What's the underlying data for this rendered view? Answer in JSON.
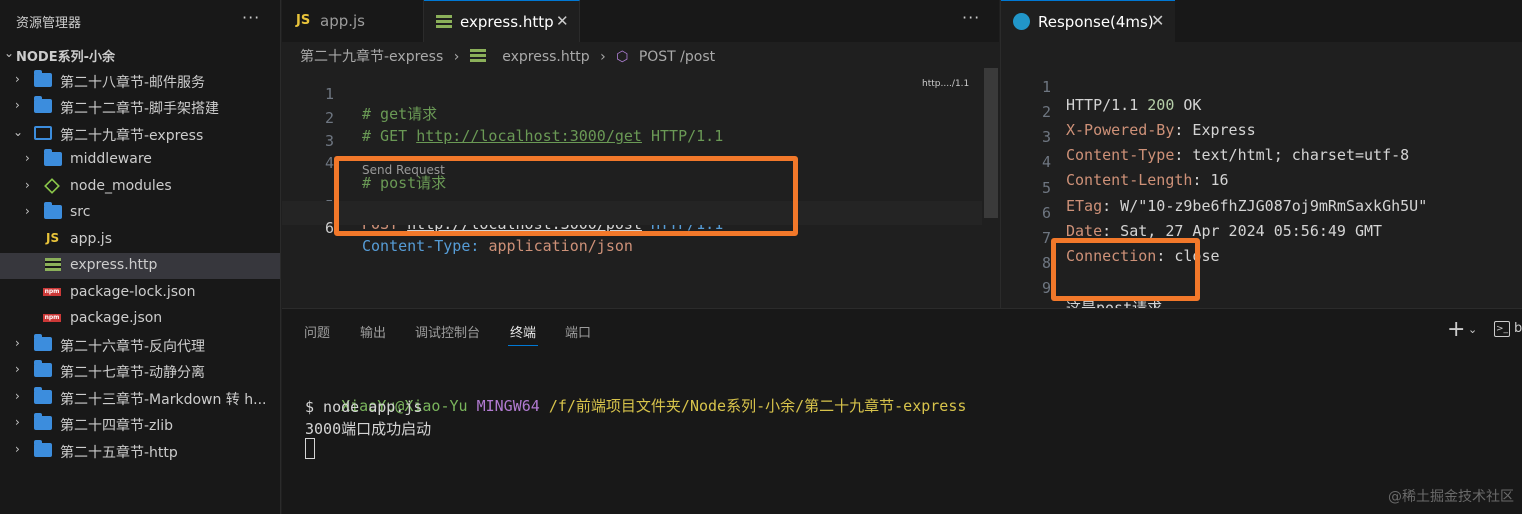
{
  "sidebar": {
    "title": "资源管理器",
    "more": "···",
    "root": "NODE系列-小余",
    "items": [
      {
        "label": "第二十八章节-邮件服务"
      },
      {
        "label": "第二十二章节-脚手架搭建"
      },
      {
        "label": "第二十九章节-express"
      },
      {
        "label": "middleware"
      },
      {
        "label": "node_modules"
      },
      {
        "label": "src"
      },
      {
        "label": "app.js"
      },
      {
        "label": "express.http"
      },
      {
        "label": "package-lock.json"
      },
      {
        "label": "package.json"
      },
      {
        "label": "第二十六章节-反向代理"
      },
      {
        "label": "第二十七章节-动静分离"
      },
      {
        "label": "第二十三章节-Markdown 转 h..."
      },
      {
        "label": "第二十四章节-zlib"
      },
      {
        "label": "第二十五章节-http"
      }
    ]
  },
  "editor": {
    "tabs": [
      {
        "icon": "JS",
        "label": "app.js"
      },
      {
        "label": "express.http",
        "close": "✕"
      }
    ],
    "more": "···",
    "breadcrumb": {
      "folder": "第二十九章节-express",
      "sep1": "›",
      "file": "express.http",
      "sep2": "›",
      "symbol": "POST /post"
    },
    "code_lens": "Send Request",
    "minimap_label": "http..../1.1",
    "lines": [
      {
        "n": "1",
        "comment": "# get请求"
      },
      {
        "n": "2",
        "comment_a": "# GET ",
        "link": "http://localhost:3000/get",
        "comment_b": " HTTP/1.1"
      },
      {
        "n": "3"
      },
      {
        "n": "4",
        "comment": "# post请求"
      },
      {
        "n": "5",
        "method": "POST ",
        "url": "http://localhost:3000/post",
        "version": " HTTP/1.1"
      },
      {
        "n": "6",
        "key": "Content-Type: ",
        "value": "application/json"
      }
    ]
  },
  "response": {
    "tab_label": "Response(4ms)",
    "close": "✕",
    "lines": [
      {
        "n": "1",
        "a": "HTTP/1.1 ",
        "b": "200",
        "c": " OK"
      },
      {
        "n": "2",
        "name": "X-Powered-By",
        "value": ": Express"
      },
      {
        "n": "3",
        "name": "Content-Type",
        "value": ": text/html; charset=utf-8"
      },
      {
        "n": "4",
        "name": "Content-Length",
        "value": ": 16"
      },
      {
        "n": "5",
        "name": "ETag",
        "value": ": W/\"10-z9be6fhZJG087oj9mRmSaxkGh5U\""
      },
      {
        "n": "6",
        "name": "Date",
        "value": ": Sat, 27 Apr 2024 05:56:49 GMT"
      },
      {
        "n": "7",
        "name": "Connection",
        "value": ": close"
      },
      {
        "n": "8"
      },
      {
        "n": "9",
        "body": "这是post请求"
      }
    ]
  },
  "panel": {
    "tabs": [
      "问题",
      "输出",
      "调试控制台",
      "终端",
      "端口"
    ],
    "active_tab": "终端",
    "add": "+",
    "chevron": "⌄",
    "cut_text": "b",
    "terminal": {
      "user": "XiaoYu@Xiao-Yu",
      "shell": "MINGW64",
      "path": "/f/前端项目文件夹/Node系列-小余/第二十九章节-express",
      "command": "$ node app.js",
      "output": "3000端口成功启动"
    }
  },
  "watermark": "@稀土掘金技术社区",
  "colors": {
    "highlight": "#f2782a",
    "accent": "#0078d4"
  }
}
